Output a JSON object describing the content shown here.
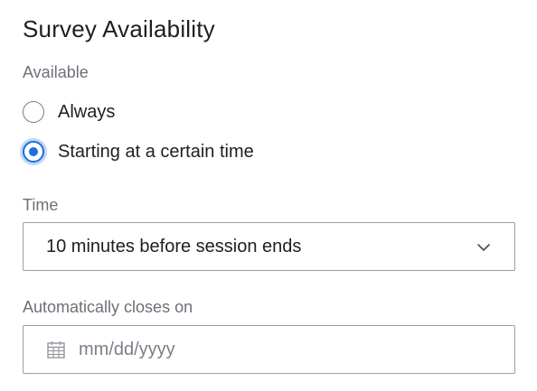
{
  "title": "Survey Availability",
  "available": {
    "label": "Available",
    "options": [
      {
        "label": "Always",
        "checked": false
      },
      {
        "label": "Starting at a certain time",
        "checked": true
      }
    ]
  },
  "time": {
    "label": "Time",
    "selected": "10 minutes before session ends",
    "icon": "chevron-down-icon"
  },
  "closes": {
    "label": "Automatically closes on",
    "placeholder": "mm/dd/yyyy",
    "icon": "calendar-icon"
  },
  "colors": {
    "accent": "#1f6fd9",
    "border": "#9aa0a6",
    "muted_text": "#6b7178"
  }
}
